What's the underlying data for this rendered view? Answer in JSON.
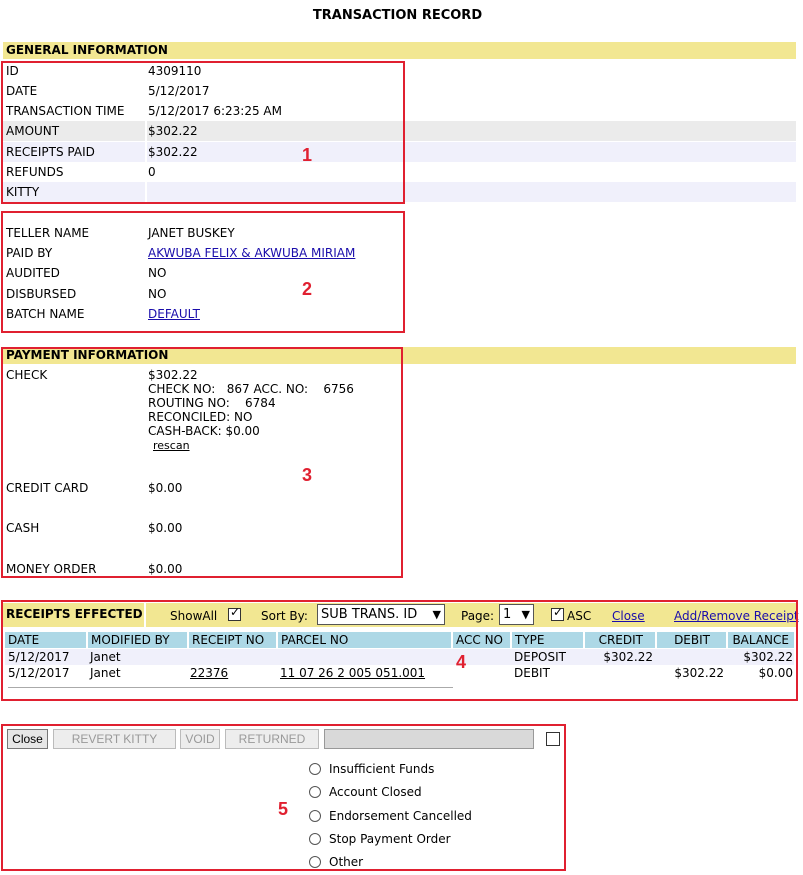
{
  "title": "TRANSACTION RECORD",
  "general": {
    "header": "GENERAL INFORMATION",
    "rows": [
      {
        "label": "ID",
        "value": "4309110"
      },
      {
        "label": "DATE",
        "value": "5/12/2017"
      },
      {
        "label": "TRANSACTION TIME",
        "value": "5/12/2017 6:23:25 AM"
      },
      {
        "label": "AMOUNT",
        "value": "$302.22"
      },
      {
        "label": "RECEIPTS PAID",
        "value": "$302.22"
      },
      {
        "label": "REFUNDS",
        "value": "0"
      },
      {
        "label": "KITTY",
        "value": ""
      }
    ]
  },
  "teller": {
    "rows": [
      {
        "label": "TELLER NAME",
        "value": "JANET BUSKEY"
      },
      {
        "label": "PAID BY",
        "value": "AKWUBA FELIX & AKWUBA MIRIAM"
      },
      {
        "label": "AUDITED",
        "value": "NO"
      },
      {
        "label": "DISBURSED",
        "value": "NO"
      },
      {
        "label": "BATCH NAME",
        "value": "DEFAULT"
      }
    ]
  },
  "payment": {
    "header": "PAYMENT INFORMATION",
    "check_label": "CHECK",
    "check_amount": "$302.22",
    "check_no_line": "CHECK NO:   867 ACC. NO:    6756",
    "routing_line": "ROUTING NO:    6784",
    "reconciled_line": "RECONCILED: NO",
    "cashback_line": "CASH-BACK: $0.00",
    "rescan": "rescan",
    "credit_label": "CREDIT CARD",
    "credit_value": "$0.00",
    "cash_label": "CASH",
    "cash_value": "$0.00",
    "mo_label": "MONEY ORDER",
    "mo_value": "$0.00"
  },
  "receipts": {
    "header": "RECEIPTS EFFECTED",
    "showall": "ShowAll",
    "sortby": "Sort By:",
    "sort_value": "SUB TRANS. ID",
    "page_label": "Page:",
    "page_value": "1",
    "asc": "ASC",
    "close": "Close",
    "add_remove": "Add/Remove Receipt",
    "columns": [
      "DATE",
      "MODIFIED BY",
      "RECEIPT NO",
      "PARCEL NO",
      "ACC NO",
      "TYPE",
      "CREDIT",
      "DEBIT",
      "BALANCE"
    ],
    "rows": [
      [
        "5/12/2017",
        "Janet",
        "",
        "",
        "",
        "DEPOSIT",
        "$302.22",
        "",
        "$302.22"
      ],
      [
        "5/12/2017",
        "Janet",
        "22376",
        "11 07 26 2 005 051.001",
        "",
        "DEBIT",
        "",
        "$302.22",
        "$0.00"
      ]
    ]
  },
  "actions": {
    "close": "Close",
    "revert_kitty": "REVERT KITTY",
    "void": "VOID",
    "returned": "RETURNED",
    "reasons": [
      "Insufficient Funds",
      "Account Closed",
      "Endorsement Cancelled",
      "Stop Payment Order",
      "Other"
    ]
  },
  "annotations": [
    "1",
    "2",
    "3",
    "4",
    "5"
  ],
  "colors": {
    "section": "#f2e792",
    "header_blue": "#add8e6",
    "annotation": "#e02030",
    "link": "#1a0dab"
  }
}
